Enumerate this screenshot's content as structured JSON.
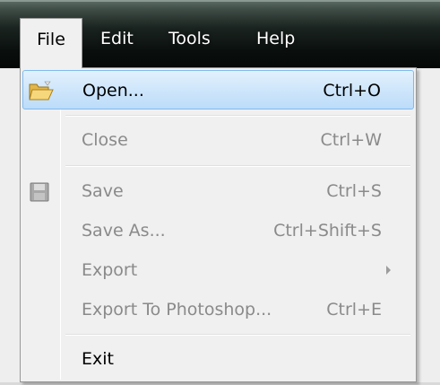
{
  "menubar": {
    "items": [
      {
        "label": "File"
      },
      {
        "label": "Edit"
      },
      {
        "label": "Tools"
      },
      {
        "label": "Help"
      }
    ]
  },
  "file_menu": {
    "items": [
      {
        "label": "Open...",
        "shortcut": "Ctrl+O",
        "icon": "folder-open-icon",
        "enabled": true,
        "highlighted": true
      },
      {
        "label": "Close",
        "shortcut": "Ctrl+W",
        "enabled": false
      },
      {
        "label": "Save",
        "shortcut": "Ctrl+S",
        "icon": "floppy-disk-icon",
        "enabled": false
      },
      {
        "label": "Save As...",
        "shortcut": "Ctrl+Shift+S",
        "enabled": false
      },
      {
        "label": "Export",
        "shortcut": "",
        "submenu": true,
        "enabled": false
      },
      {
        "label": "Export To Photoshop...",
        "shortcut": "Ctrl+E",
        "enabled": false
      },
      {
        "label": "Exit",
        "shortcut": "",
        "enabled": true
      }
    ]
  },
  "colors": {
    "highlight_border": "#7fbaee",
    "highlight_fill": "#cfe6fb",
    "disabled_text": "#8a8a8a",
    "menubar_dark": "#0a0f0d"
  }
}
